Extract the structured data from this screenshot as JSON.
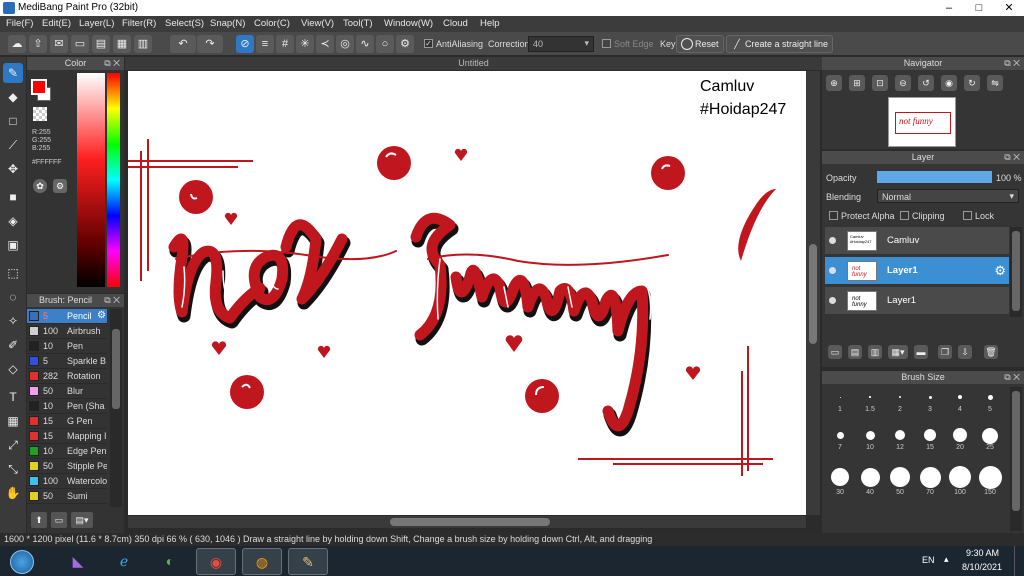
{
  "window": {
    "title": "MediBang Paint Pro (32bit)"
  },
  "menu": [
    "File(F)",
    "Edit(E)",
    "Layer(L)",
    "Filter(R)",
    "Select(S)",
    "Snap(N)",
    "Color(C)",
    "View(V)",
    "Tool(T)",
    "Window(W)",
    "Cloud",
    "Help"
  ],
  "toolbar": {
    "antialiasing_label": "AntiAliasing",
    "correction_label": "Correction",
    "correction_value": "40",
    "soft_edge_label": "Soft Edge",
    "key_label": "Key",
    "reset_label": "Reset",
    "straight_line_label": "Create a straight line"
  },
  "color_panel": {
    "title": "Color",
    "r": "R:255",
    "g": "G:255",
    "b": "B:255",
    "hex": "#FFFFFF",
    "foreground": "#ff0000",
    "background": "#ffffff"
  },
  "brush_panel": {
    "title": "Brush: Pencil",
    "brushes": [
      {
        "size": "5",
        "name": "Pencil",
        "color": "#3b6fb6"
      },
      {
        "size": "100",
        "name": "Airbrush",
        "color": "#cfcfcf"
      },
      {
        "size": "10",
        "name": "Pen",
        "color": "#222222"
      },
      {
        "size": "5",
        "name": "Sparkle B",
        "color": "#3050e0"
      },
      {
        "size": "282",
        "name": "Rotation",
        "color": "#e03030"
      },
      {
        "size": "50",
        "name": "Blur",
        "color": "#f0a0f0"
      },
      {
        "size": "10",
        "name": "Pen (Sha",
        "color": "#222222"
      },
      {
        "size": "15",
        "name": "G Pen",
        "color": "#e03030"
      },
      {
        "size": "15",
        "name": "Mapping I",
        "color": "#e03030"
      },
      {
        "size": "10",
        "name": "Edge Pen",
        "color": "#20a020"
      },
      {
        "size": "50",
        "name": "Stipple Pe",
        "color": "#e0d020"
      },
      {
        "size": "100",
        "name": "Watercolo",
        "color": "#40c0f0"
      },
      {
        "size": "50",
        "name": "Sumi",
        "color": "#e0d020"
      }
    ]
  },
  "canvas": {
    "tab_title": "Untitled",
    "signature": "Camluv",
    "tag": "#Hoidap247",
    "artwork_text": "not funny"
  },
  "navigator": {
    "title": "Navigator"
  },
  "layer_panel": {
    "title": "Layer",
    "opacity_label": "Opacity",
    "opacity_value": "100 %",
    "opacity_fraction": 1.0,
    "blending_label": "Blending",
    "blending_value": "Normal",
    "protect_alpha_label": "Protect Alpha",
    "clipping_label": "Clipping",
    "lock_label": "Lock",
    "layers": [
      {
        "name": "Camluv",
        "selected": false
      },
      {
        "name": "Layer1",
        "selected": true
      },
      {
        "name": "Layer1",
        "selected": false
      }
    ]
  },
  "brush_size_panel": {
    "title": "Brush Size",
    "sizes": [
      "1",
      "1.5",
      "2",
      "3",
      "4",
      "5",
      "7",
      "10",
      "12",
      "15",
      "20",
      "25",
      "30",
      "40",
      "50",
      "70",
      "100",
      "150"
    ]
  },
  "status": {
    "text": "1600 * 1200 pixel   (11.6 * 8.7cm)   350 dpi   66 %   ( 630, 1046 )   Draw a straight line by holding down Shift, Change a brush size by holding down Ctrl, Alt, and dragging"
  },
  "taskbar": {
    "language": "EN",
    "time": "9:30 AM",
    "date": "8/10/2021"
  }
}
